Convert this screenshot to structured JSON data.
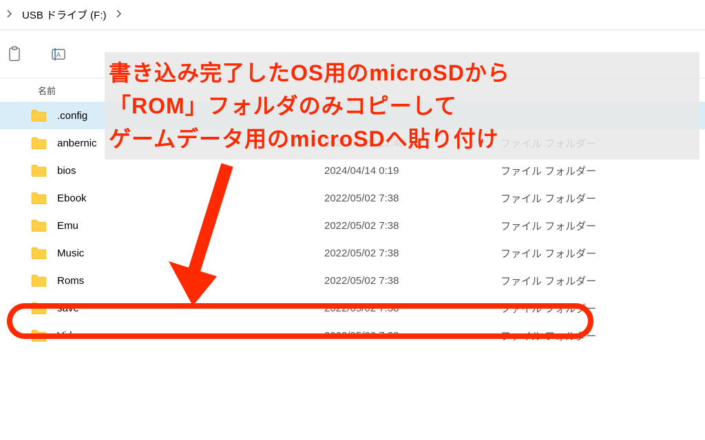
{
  "breadcrumb": {
    "label": "USB ドライブ (F:)"
  },
  "columns": {
    "name": "名前",
    "date": "",
    "type": ""
  },
  "files": [
    {
      "name": ".config",
      "date": "",
      "type": ""
    },
    {
      "name": "anbernic",
      "date": "2024/09/24 22:40",
      "type": "ファイル フォルダー"
    },
    {
      "name": "bios",
      "date": "2024/04/14 0:19",
      "type": "ファイル フォルダー"
    },
    {
      "name": "Ebook",
      "date": "2022/05/02 7:38",
      "type": "ファイル フォルダー"
    },
    {
      "name": "Emu",
      "date": "2022/05/02 7:38",
      "type": "ファイル フォルダー"
    },
    {
      "name": "Music",
      "date": "2022/05/02 7:38",
      "type": "ファイル フォルダー"
    },
    {
      "name": "Roms",
      "date": "2022/05/02 7:38",
      "type": "ファイル フォルダー"
    },
    {
      "name": "save",
      "date": "2022/05/02 7:38",
      "type": "ファイル フォルダー"
    },
    {
      "name": "Video",
      "date": "2022/05/02 7:38",
      "type": "ファイル フォルダー"
    }
  ],
  "annotation": {
    "line1": "書き込み完了したOS用のmicroSDから",
    "line2": "「ROM」フォルダのみコピーして",
    "line3": "ゲームデータ用のmicroSDへ貼り付け"
  }
}
